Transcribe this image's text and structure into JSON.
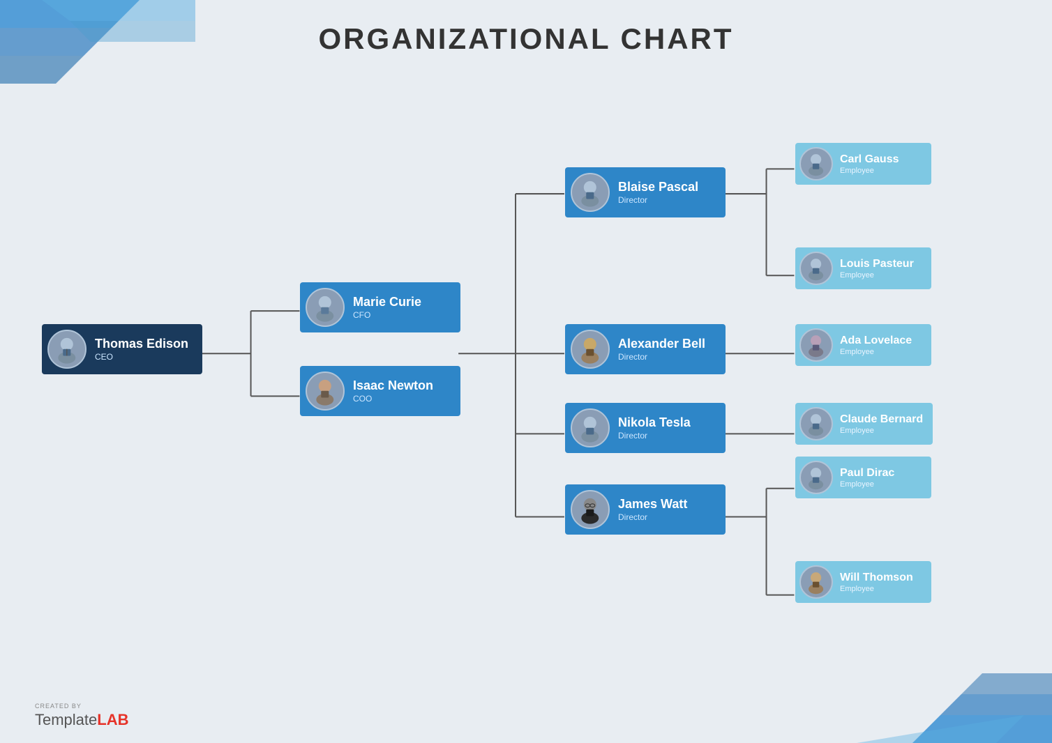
{
  "title": "ORGANIZATIONAL CHART",
  "nodes": {
    "ceo": {
      "name": "Thomas Edison",
      "role": "CEO",
      "type": "dark"
    },
    "cfo": {
      "name": "Marie Curie",
      "role": "CFO",
      "type": "blue"
    },
    "coo": {
      "name": "Isaac Newton",
      "role": "COO",
      "type": "blue"
    },
    "dir1": {
      "name": "Blaise Pascal",
      "role": "Director",
      "type": "blue"
    },
    "dir2": {
      "name": "Alexander Bell",
      "role": "Director",
      "type": "blue"
    },
    "dir3": {
      "name": "Nikola Tesla",
      "role": "Director",
      "type": "blue"
    },
    "dir4": {
      "name": "James Watt",
      "role": "Director",
      "type": "blue"
    },
    "emp1": {
      "name": "Carl Gauss",
      "role": "Employee",
      "type": "light"
    },
    "emp2": {
      "name": "Louis Pasteur",
      "role": "Employee",
      "type": "light"
    },
    "emp3": {
      "name": "Ada Lovelace",
      "role": "Employee",
      "type": "light"
    },
    "emp4": {
      "name": "Claude Bernard",
      "role": "Employee",
      "type": "light"
    },
    "emp5": {
      "name": "Paul Dirac",
      "role": "Employee",
      "type": "light"
    },
    "emp6": {
      "name": "Will Thomson",
      "role": "Employee",
      "type": "light"
    }
  },
  "footer": {
    "created_by": "CREATED BY",
    "template": "Template",
    "lab": "LAB"
  }
}
